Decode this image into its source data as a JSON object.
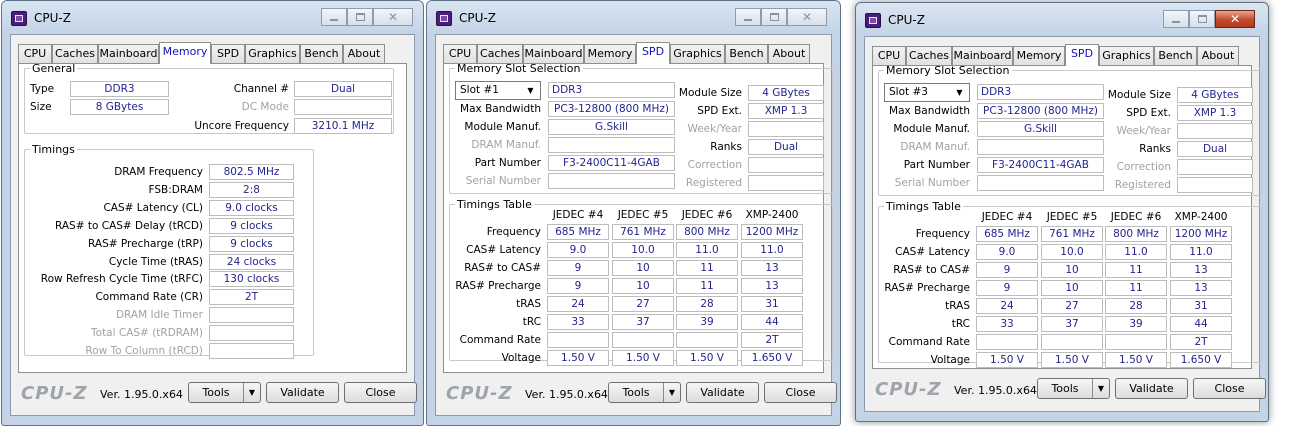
{
  "app": {
    "title": "CPU-Z",
    "logo": "CPU-Z",
    "version": "Ver. 1.95.0.x64",
    "buttons": {
      "tools": "Tools",
      "validate": "Validate",
      "close": "Close"
    },
    "tabs": [
      "CPU",
      "Caches",
      "Mainboard",
      "Memory",
      "SPD",
      "Graphics",
      "Bench",
      "About"
    ],
    "icons": {
      "app": "cpu-z-icon",
      "minimize": "minimize-icon",
      "maximize": "maximize-icon",
      "close": "close-icon",
      "dropdown": "chevron-down-icon"
    },
    "colors": {
      "value_text": "#24248f",
      "active_tab_text": "#1010c0",
      "close_button_hover": "#c44a2c"
    }
  },
  "memory": {
    "general_title": "General",
    "type_label": "Type",
    "type_value": "DDR3",
    "size_label": "Size",
    "size_value": "8 GBytes",
    "channel_label": "Channel #",
    "channel_value": "Dual",
    "dc_mode_label": "DC Mode",
    "dc_mode_value": "",
    "uncore_label": "Uncore Frequency",
    "uncore_value": "3210.1 MHz",
    "timings_title": "Timings",
    "timings": [
      {
        "label": "DRAM Frequency",
        "value": "802.5 MHz",
        "disabled": false
      },
      {
        "label": "FSB:DRAM",
        "value": "2:8",
        "disabled": false
      },
      {
        "label": "CAS# Latency (CL)",
        "value": "9.0 clocks",
        "disabled": false
      },
      {
        "label": "RAS# to CAS# Delay (tRCD)",
        "value": "9 clocks",
        "disabled": false
      },
      {
        "label": "RAS# Precharge (tRP)",
        "value": "9 clocks",
        "disabled": false
      },
      {
        "label": "Cycle Time (tRAS)",
        "value": "24 clocks",
        "disabled": false
      },
      {
        "label": "Row Refresh Cycle Time (tRFC)",
        "value": "130 clocks",
        "disabled": false
      },
      {
        "label": "Command Rate (CR)",
        "value": "2T",
        "disabled": false
      },
      {
        "label": "DRAM Idle Timer",
        "value": "",
        "disabled": true
      },
      {
        "label": "Total CAS# (tRDRAM)",
        "value": "",
        "disabled": true
      },
      {
        "label": "Row To Column (tRCD)",
        "value": "",
        "disabled": true
      }
    ]
  },
  "spd_labels": {
    "slot_title": "Memory Slot Selection",
    "max_bandwidth": "Max Bandwidth",
    "module_manuf": "Module Manuf.",
    "dram_manuf": "DRAM Manuf.",
    "part_number": "Part Number",
    "serial_number": "Serial Number",
    "module_size": "Module Size",
    "spd_ext": "SPD Ext.",
    "week_year": "Week/Year",
    "ranks": "Ranks",
    "correction": "Correction",
    "registered": "Registered",
    "timings_table_title": "Timings Table",
    "columns": [
      "JEDEC #4",
      "JEDEC #5",
      "JEDEC #6",
      "XMP-2400"
    ],
    "rows": [
      {
        "label": "Frequency",
        "values": [
          "685 MHz",
          "761 MHz",
          "800 MHz",
          "1200 MHz"
        ]
      },
      {
        "label": "CAS# Latency",
        "values": [
          "9.0",
          "10.0",
          "11.0",
          "11.0"
        ]
      },
      {
        "label": "RAS# to CAS#",
        "values": [
          "9",
          "10",
          "11",
          "13"
        ]
      },
      {
        "label": "RAS# Precharge",
        "values": [
          "9",
          "10",
          "11",
          "13"
        ]
      },
      {
        "label": "tRAS",
        "values": [
          "24",
          "27",
          "28",
          "31"
        ]
      },
      {
        "label": "tRC",
        "values": [
          "33",
          "37",
          "39",
          "44"
        ]
      },
      {
        "label": "Command Rate",
        "values": [
          "",
          "",
          "",
          "2T"
        ]
      },
      {
        "label": "Voltage",
        "values": [
          "1.50 V",
          "1.50 V",
          "1.50 V",
          "1.650 V"
        ]
      }
    ]
  },
  "spd1": {
    "slot": "Slot #1",
    "type": "DDR3",
    "max_bandwidth": "PC3-12800 (800 MHz)",
    "module_manuf": "G.Skill",
    "dram_manuf": "",
    "part_number": "F3-2400C11-4GAB",
    "serial_number": "",
    "module_size": "4 GBytes",
    "spd_ext": "XMP 1.3",
    "week_year": "",
    "ranks": "Dual",
    "correction": "",
    "registered": ""
  },
  "spd3": {
    "slot": "Slot #3",
    "type": "DDR3",
    "max_bandwidth": "PC3-12800 (800 MHz)",
    "module_manuf": "G.Skill",
    "dram_manuf": "",
    "part_number": "F3-2400C11-4GAB",
    "serial_number": "",
    "module_size": "4 GBytes",
    "spd_ext": "XMP 1.3",
    "week_year": "",
    "ranks": "Dual",
    "correction": "",
    "registered": ""
  }
}
